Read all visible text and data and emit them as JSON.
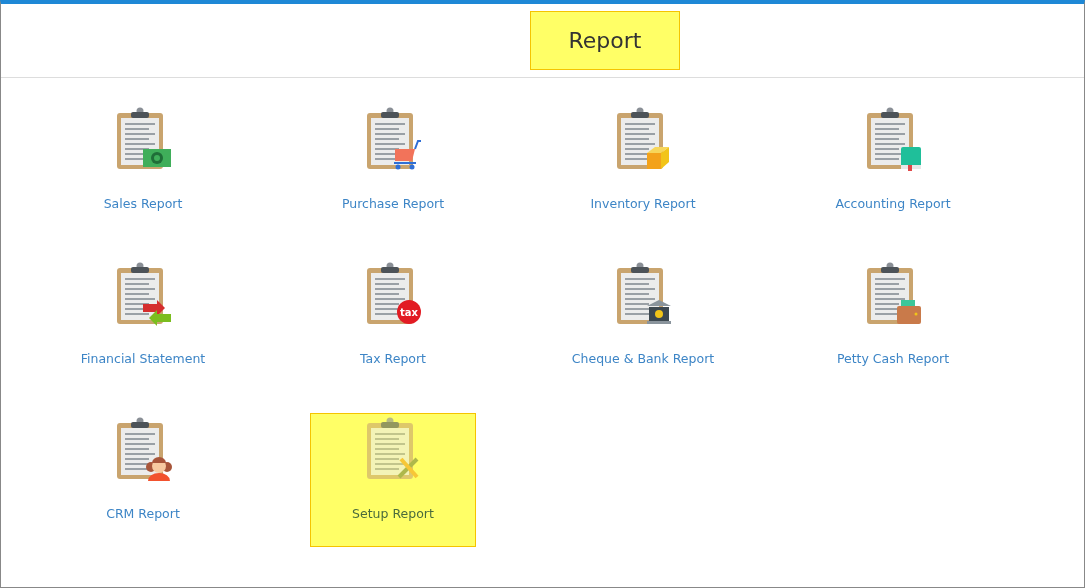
{
  "title": {
    "text": "Report",
    "highlighted": true
  },
  "reports": [
    {
      "label": "Sales Report",
      "kind": "money",
      "selected": false
    },
    {
      "label": "Purchase Report",
      "kind": "cart",
      "selected": false
    },
    {
      "label": "Inventory Report",
      "kind": "box",
      "selected": false
    },
    {
      "label": "Accounting Report",
      "kind": "book",
      "selected": false
    },
    {
      "label": "Financial Statement",
      "kind": "exchange",
      "selected": false
    },
    {
      "label": "Tax Report",
      "kind": "tax",
      "badge": "tax",
      "selected": false
    },
    {
      "label": "Cheque & Bank Report",
      "kind": "bank",
      "selected": false
    },
    {
      "label": "Petty Cash Report",
      "kind": "wallet",
      "selected": false
    },
    {
      "label": "CRM Report",
      "kind": "people",
      "selected": false
    },
    {
      "label": "Setup Report",
      "kind": "tools",
      "selected": true
    }
  ]
}
